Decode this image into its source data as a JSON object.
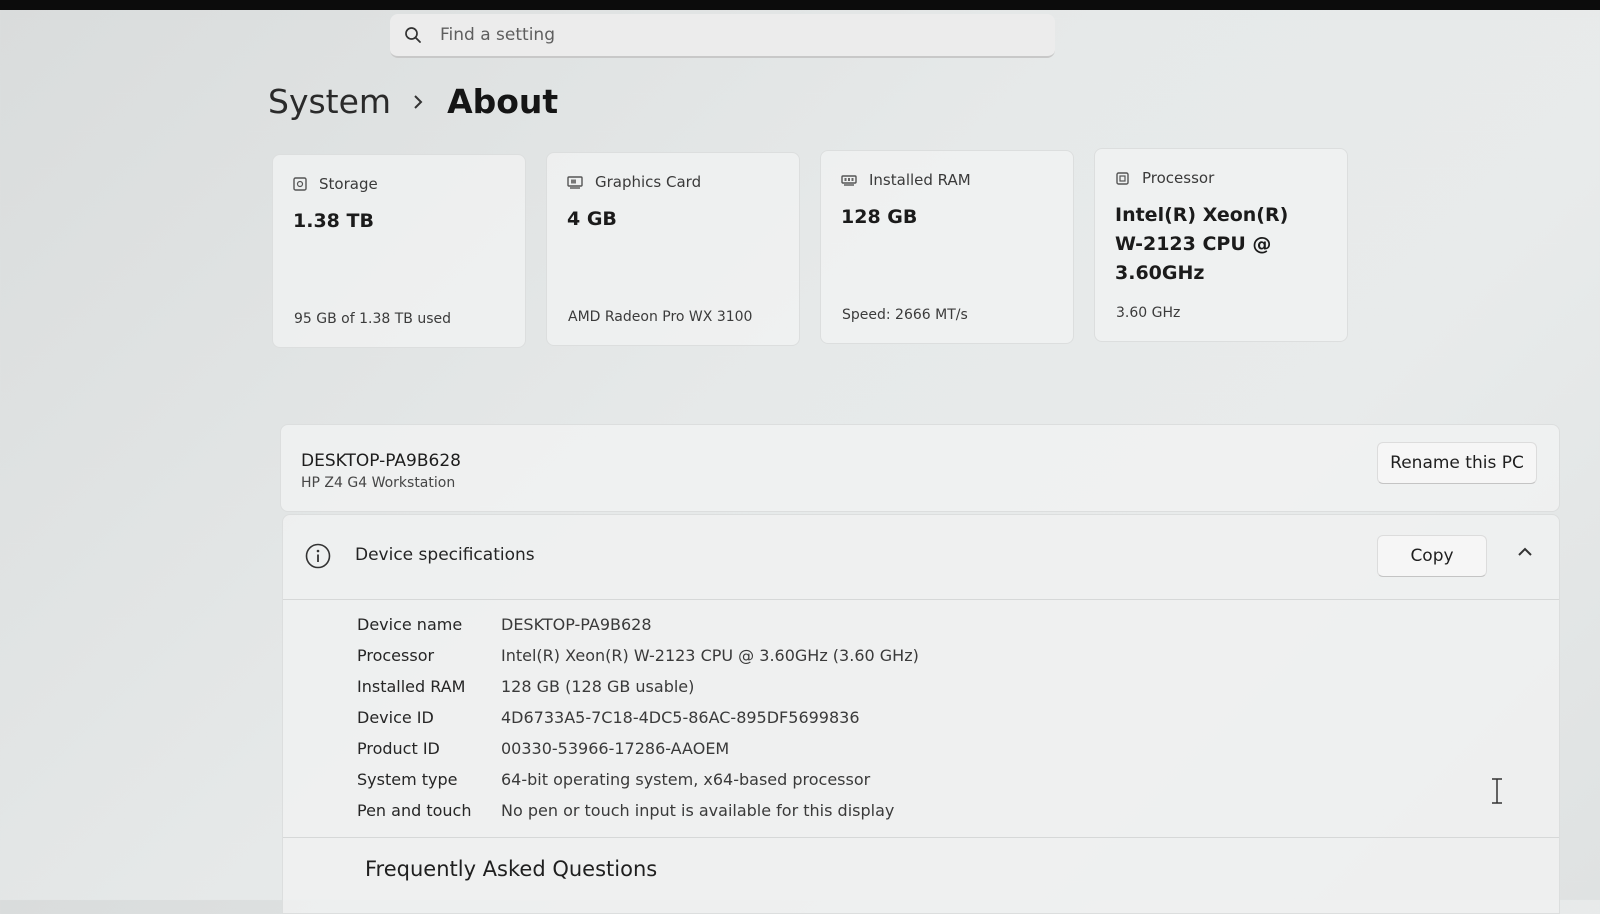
{
  "search": {
    "placeholder": "Find a setting"
  },
  "breadcrumb": {
    "parent": "System",
    "current": "About"
  },
  "cards": [
    {
      "label": "Storage",
      "value": "1.38 TB",
      "sub": "95 GB of 1.38 TB used",
      "icon": "storage-icon"
    },
    {
      "label": "Graphics Card",
      "value": "4 GB",
      "sub": "AMD Radeon Pro WX 3100",
      "icon": "graphics-card-icon"
    },
    {
      "label": "Installed RAM",
      "value": "128 GB",
      "sub": "Speed: 2666 MT/s",
      "icon": "ram-icon"
    },
    {
      "label": "Processor",
      "value": "Intel(R) Xeon(R) W-2123 CPU @ 3.60GHz",
      "sub": "3.60 GHz",
      "icon": "processor-icon"
    }
  ],
  "pc": {
    "name": "DESKTOP-PA9B628",
    "model": "HP Z4 G4 Workstation",
    "rename_label": "Rename this PC"
  },
  "specs": {
    "title": "Device specifications",
    "copy_label": "Copy",
    "rows": [
      {
        "key": "Device name",
        "value": "DESKTOP-PA9B628"
      },
      {
        "key": "Processor",
        "value": "Intel(R) Xeon(R) W-2123 CPU @ 3.60GHz (3.60 GHz)"
      },
      {
        "key": "Installed RAM",
        "value": "128 GB (128 GB usable)"
      },
      {
        "key": "Device ID",
        "value": "4D6733A5-7C18-4DC5-86AC-895DF5699836"
      },
      {
        "key": "Product ID",
        "value": "00330-53966-17286-AAOEM"
      },
      {
        "key": "System type",
        "value": "64-bit operating system, x64-based processor"
      },
      {
        "key": "Pen and touch",
        "value": "No pen or touch input is available for this display"
      }
    ]
  },
  "faq": {
    "title": "Frequently Asked Questions"
  },
  "colors": {
    "background": "#e3e6e6",
    "card": "#f1f2f2",
    "topbar": "#0c0c0c"
  }
}
